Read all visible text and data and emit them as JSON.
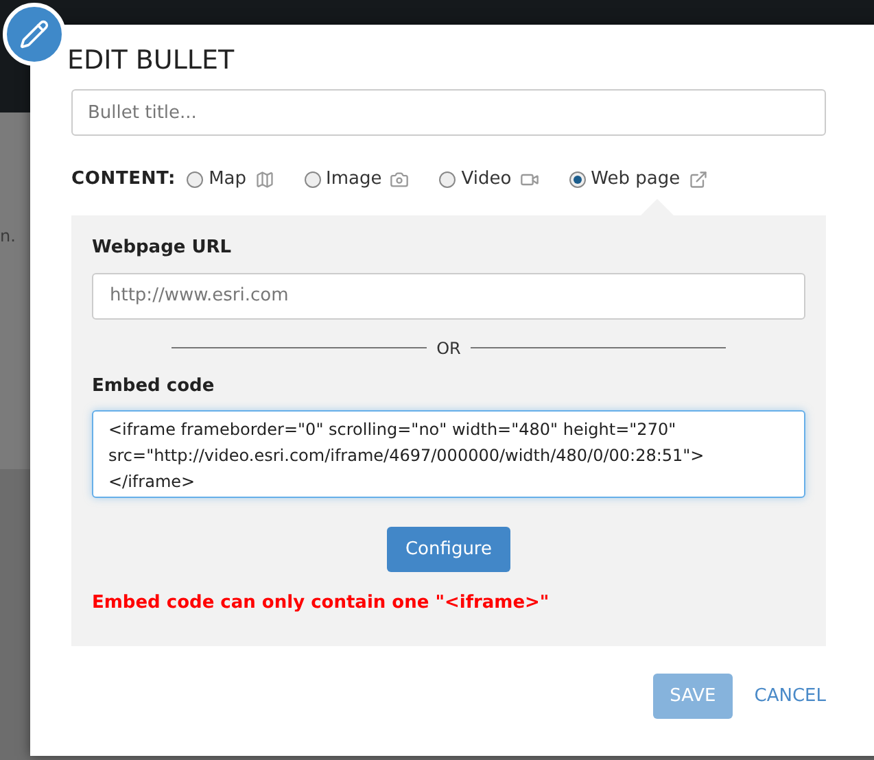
{
  "background": {
    "text_fragment": "n."
  },
  "dialog": {
    "title": "EDIT BULLET",
    "title_field": {
      "placeholder": "Bullet title..."
    },
    "content": {
      "label": "CONTENT:",
      "options": [
        {
          "label": "Map",
          "kind": "map",
          "selected": false
        },
        {
          "label": "Image",
          "kind": "image",
          "selected": false
        },
        {
          "label": "Video",
          "kind": "video",
          "selected": false
        },
        {
          "label": "Web page",
          "kind": "webpage",
          "selected": true
        }
      ]
    },
    "webpage_url": {
      "label": "Webpage URL",
      "placeholder": "http://www.esri.com"
    },
    "separator": "OR",
    "embed_code": {
      "label": "Embed code",
      "value": "<iframe frameborder=\"0\" scrolling=\"no\" width=\"480\" height=\"270\" src=\"http://video.esri.com/iframe/4697/000000/width/480/0/00:28:51\"></iframe>"
    },
    "configure_button": "Configure",
    "error": "Embed code can only contain one \"<iframe>\"",
    "buttons": [
      {
        "label": "SAVE",
        "kind": "primary",
        "disabled": true
      },
      {
        "label": "CANCEL",
        "kind": "link",
        "disabled": false
      }
    ]
  }
}
